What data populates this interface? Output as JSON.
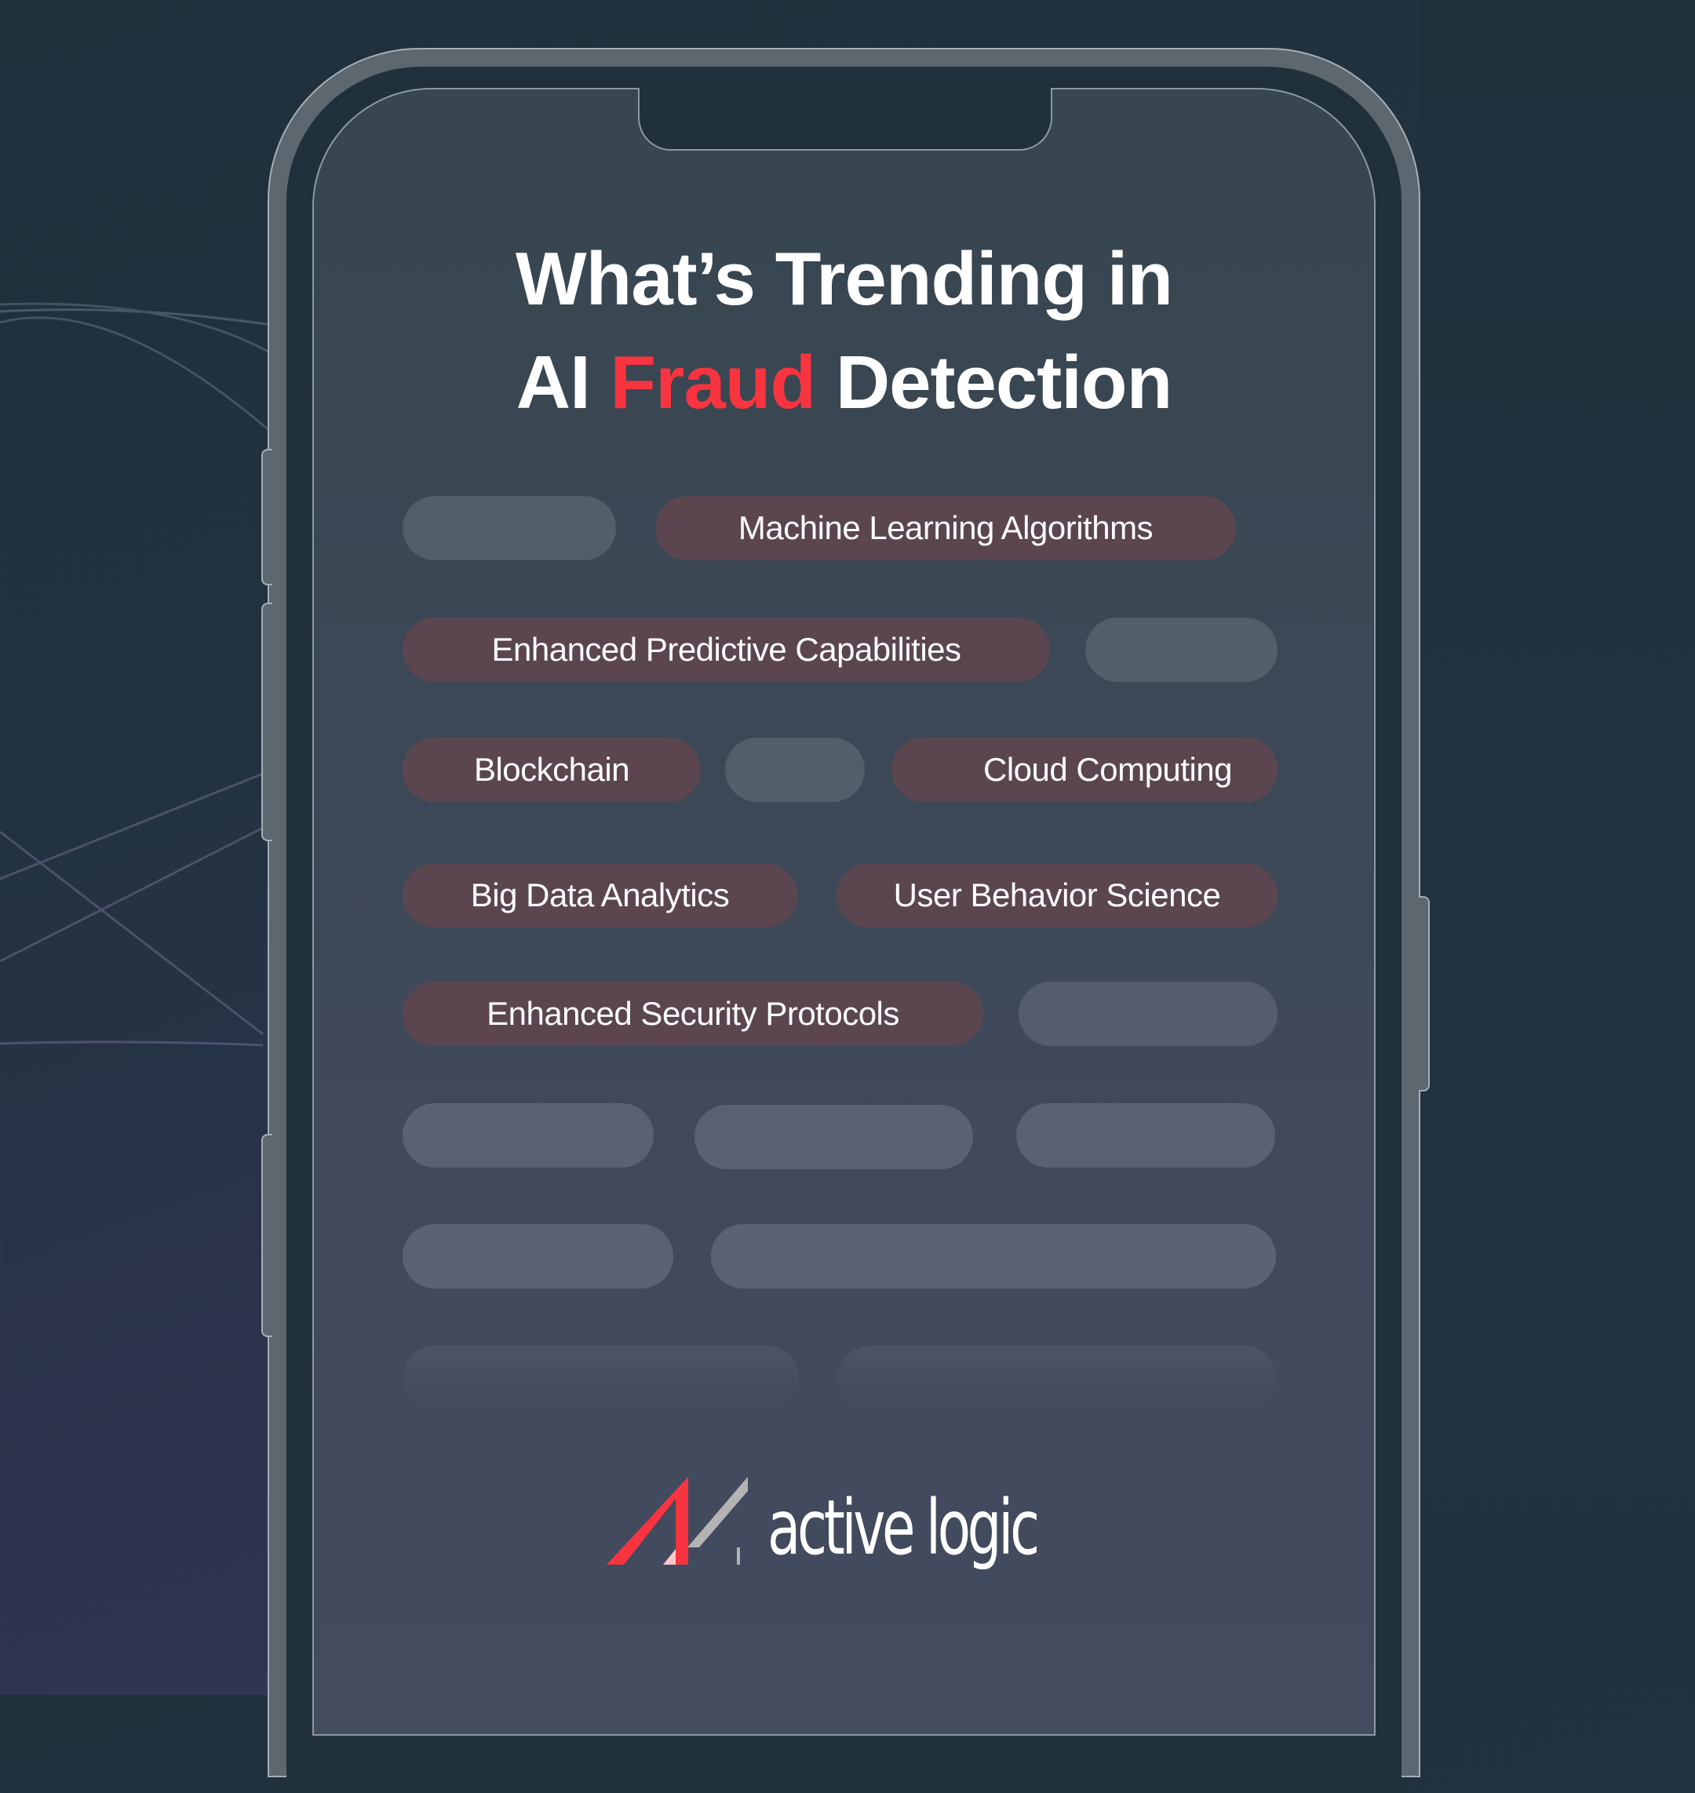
{
  "title": {
    "line1": "What’s Trending in",
    "line2_prefix": "AI",
    "line2_accent": "Fraud",
    "line2_suffix": "Detection"
  },
  "colors": {
    "accent": "#f7343f",
    "active_pill": "#5b4650",
    "placeholder_pill": "#525e69",
    "screen_top": "#37464f",
    "screen_bottom": "#434b5e",
    "frame": "#5c6770",
    "background_top": "#1f303b",
    "background_bottom": "#393a58"
  },
  "tags": [
    {
      "label": "Machine Learning Algorithms"
    },
    {
      "label": "Enhanced Predictive Capabilities"
    },
    {
      "label": "Blockchain"
    },
    {
      "label": "Cloud Computing"
    },
    {
      "label": "Big Data Analytics"
    },
    {
      "label": "User Behavior Science"
    },
    {
      "label": "Enhanced Security Protocols"
    }
  ],
  "logo": {
    "icon": "active-logic-AL-mark",
    "text": "active logic"
  }
}
